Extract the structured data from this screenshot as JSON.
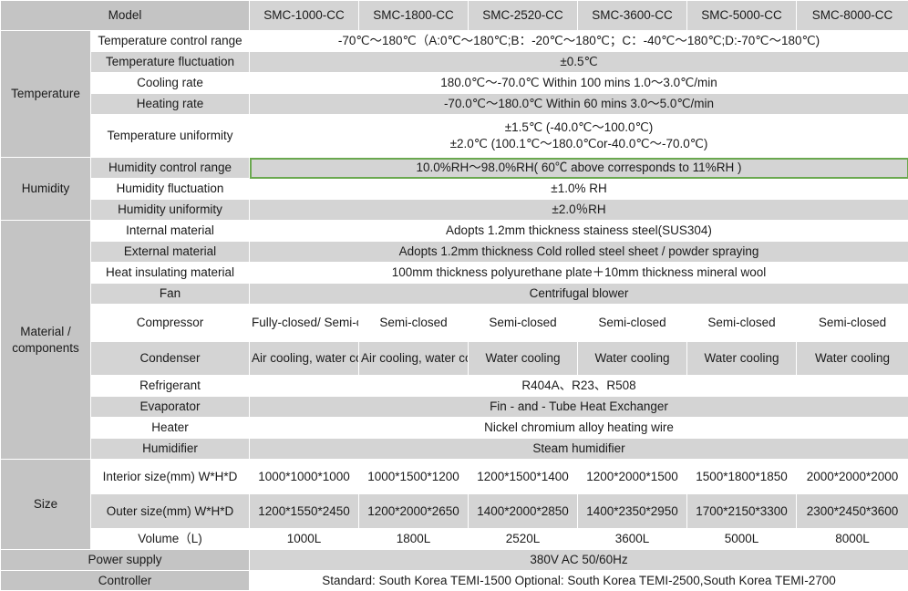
{
  "header": {
    "label": "Model",
    "models": [
      "SMC-1000-CC",
      "SMC-1800-CC",
      "SMC-2520-CC",
      "SMC-3600-CC",
      "SMC-5000-CC",
      "SMC-8000-CC"
    ]
  },
  "temperature": {
    "category": "Temperature",
    "control_range": {
      "label": "Temperature control range",
      "value": "-70℃～180℃（A:0℃～180℃;B：-20℃～180℃；C：-40℃～180℃;D:-70℃～180℃)"
    },
    "fluctuation": {
      "label": "Temperature fluctuation",
      "value": "±0.5℃"
    },
    "cooling_rate": {
      "label": "Cooling rate",
      "value": "180.0℃～-70.0℃  Within 100 mins 1.0～3.0℃/min"
    },
    "heating_rate": {
      "label": "Heating rate",
      "value": "-70.0℃～180.0℃ Within 60 mins 3.0～5.0℃/min"
    },
    "uniformity": {
      "label": "Temperature uniformity",
      "line1": "±1.5℃ (-40.0℃～100.0℃)",
      "line2": "±2.0℃ (100.1℃～180.0℃or-40.0℃～-70.0℃)"
    }
  },
  "humidity": {
    "category": "Humidity",
    "control_range": {
      "label": "Humidity control range",
      "value": "10.0%RH～98.0%RH( 60℃ above corresponds to 11%RH )"
    },
    "fluctuation": {
      "label": "Humidity fluctuation",
      "value": "±1.0% RH"
    },
    "uniformity": {
      "label": "Humidity uniformity",
      "value": "±2.0％RH"
    }
  },
  "materials": {
    "category": "Material /\ncomponents",
    "internal": {
      "label": "Internal material",
      "value": "Adopts 1.2mm thickness stainess steel(SUS304)"
    },
    "external": {
      "label": "External material",
      "value": "Adopts 1.2mm thickness Cold rolled steel sheet / powder spraying"
    },
    "insulation": {
      "label": "Heat insulating material",
      "value": "100mm thickness polyurethane plate＋10mm thickness mineral wool"
    },
    "fan": {
      "label": "Fan",
      "value": "Centrifugal blower"
    },
    "compressor": {
      "label": "Compressor",
      "values": [
        "Fully-closed/\nSemi-closed",
        "Semi-closed",
        "Semi-closed",
        "Semi-closed",
        "Semi-closed",
        "Semi-closed"
      ]
    },
    "condenser": {
      "label": "Condenser",
      "values": [
        "Air cooling,\nwater cooling",
        "Air cooling,\nwater cooling",
        "Water cooling",
        "Water cooling",
        "Water cooling",
        "Water cooling"
      ]
    },
    "refrigerant": {
      "label": "Refrigerant",
      "value": "R404A、R23、R508"
    },
    "evaporator": {
      "label": "Evaporator",
      "value": "Fin - and - Tube Heat Exchanger"
    },
    "heater": {
      "label": "Heater",
      "value": "Nickel chromium alloy heating wire"
    },
    "humidifier": {
      "label": "Humidifier",
      "value": "Steam humidifier"
    }
  },
  "size": {
    "category": "Size",
    "interior": {
      "label": "Interior size(mm)\nW*H*D",
      "values": [
        "1000*1000*1000",
        "1000*1500*1200",
        "1200*1500*1400",
        "1200*2000*1500",
        "1500*1800*1850",
        "2000*2000*2000"
      ]
    },
    "outer": {
      "label": "Outer size(mm)\nW*H*D",
      "values": [
        "1200*1550*2450",
        "1200*2000*2650",
        "1400*2000*2850",
        "1400*2350*2950",
        "1700*2150*3300",
        "2300*2450*3600"
      ]
    },
    "volume": {
      "label": "Volume（L)",
      "values": [
        "1000L",
        "1800L",
        "2520L",
        "3600L",
        "5000L",
        "8000L"
      ]
    }
  },
  "power": {
    "label": "Power supply",
    "value": "380V AC 50/60Hz"
  },
  "controller": {
    "label": "Controller",
    "value": "Standard: South Korea TEMI-1500    Optional: South Korea TEMI-2500,South Korea TEMI-2700"
  }
}
